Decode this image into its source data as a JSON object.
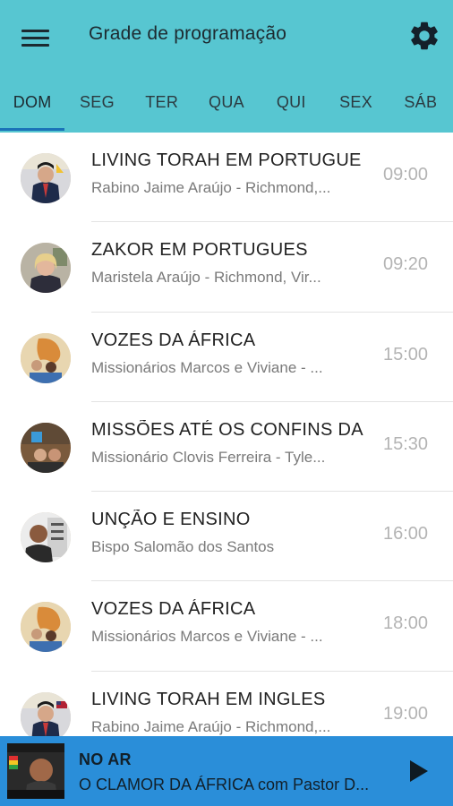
{
  "header": {
    "title": "Grade de programação",
    "menu_icon": "menu-icon",
    "settings_icon": "gear-icon",
    "background": "#57c6d1"
  },
  "tabs": [
    {
      "label": "DOM",
      "active": true
    },
    {
      "label": "SEG",
      "active": false
    },
    {
      "label": "TER",
      "active": false
    },
    {
      "label": "QUA",
      "active": false
    },
    {
      "label": "QUI",
      "active": false
    },
    {
      "label": "SEX",
      "active": false
    },
    {
      "label": "SÁB",
      "active": false
    }
  ],
  "accent": "#1a73b8",
  "programs": [
    {
      "title": "LIVING TORAH EM PORTUGUE",
      "host": "Rabino Jaime Araújo - Richmond,...",
      "time": "09:00"
    },
    {
      "title": "ZAKOR EM PORTUGUES",
      "host": "Maristela Araújo - Richmond, Vir...",
      "time": "09:20"
    },
    {
      "title": "VOZES DA ÁFRICA",
      "host": "Missionários Marcos e Viviane - ...",
      "time": "15:00"
    },
    {
      "title": "MISSÕES ATÉ OS CONFINS DA",
      "host": "Missionário Clovis Ferreira - Tyle...",
      "time": "15:30"
    },
    {
      "title": "UNÇÃO E ENSINO",
      "host": "Bispo Salomão dos Santos",
      "time": "16:00"
    },
    {
      "title": "VOZES DA ÁFRICA",
      "host": "Missionários Marcos e Viviane - ...",
      "time": "18:00"
    },
    {
      "title": "LIVING TORAH EM INGLES",
      "host": "Rabino Jaime Araújo - Richmond,...",
      "time": "19:00"
    }
  ],
  "player": {
    "status": "NO AR",
    "now_playing": "O CLAMOR DA ÁFRICA com Pastor D...",
    "play_icon": "play-icon",
    "background": "#2a8ed9"
  }
}
